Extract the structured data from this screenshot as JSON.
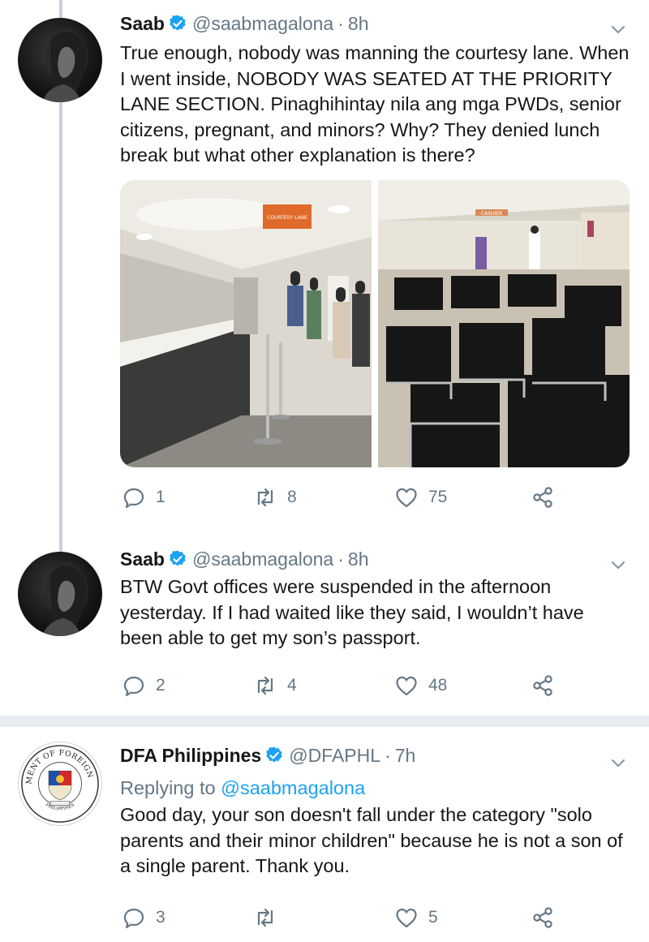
{
  "tweets": [
    {
      "name": "Saab",
      "handle": "@saabmagalona",
      "dot": "·",
      "time": "8h",
      "text": "True enough, nobody was manning the courtesy lane. When I went inside, NOBODY WAS SEATED AT THE PRIORITY LANE SECTION. Pinaghihintay nila ang mga PWDs, senior citizens, pregnant, and minors? Why? They denied lunch break but what other explanation is there?",
      "media": [
        {
          "sign": "COURTESY LANE",
          "description": "queue at courtesy lane counter"
        },
        {
          "sign": "CASHIER",
          "description": "empty waiting chairs"
        }
      ],
      "reply_count": "1",
      "retweet_count": "8",
      "like_count": "75"
    },
    {
      "name": "Saab",
      "handle": "@saabmagalona",
      "dot": "·",
      "time": "8h",
      "text": "BTW Govt offices were suspended in the afternoon yesterday. If I had waited like they said, I wouldn’t have been able to get my son’s passport.",
      "reply_count": "2",
      "retweet_count": "4",
      "like_count": "48"
    },
    {
      "name": "DFA Philippines",
      "handle": "@DFAPHL",
      "dot": "·",
      "time": "7h",
      "replying_label": "Replying to",
      "replying_handle": "@saabmagalona",
      "text": "Good day, your son doesn't fall under the category \"solo parents and their  minor children\" because he is not a son of a single parent. Thank you.",
      "reply_count": "3",
      "retweet_count": "",
      "like_count": "5",
      "avatar_seal_top": "DEPARTMENT OF FOREIGN AFFAIRS",
      "avatar_seal_bottom": "PHILIPPINES"
    }
  ],
  "colors": {
    "text": "#14171a",
    "secondary": "#657786",
    "link": "#1da1f2",
    "verified": "#1da1f2",
    "thread_line": "#c7d1d8",
    "divider": "#e6ecf0"
  },
  "icons": [
    "verified-badge-icon",
    "chevron-down-icon",
    "reply-icon",
    "retweet-icon",
    "like-icon",
    "share-icon"
  ]
}
